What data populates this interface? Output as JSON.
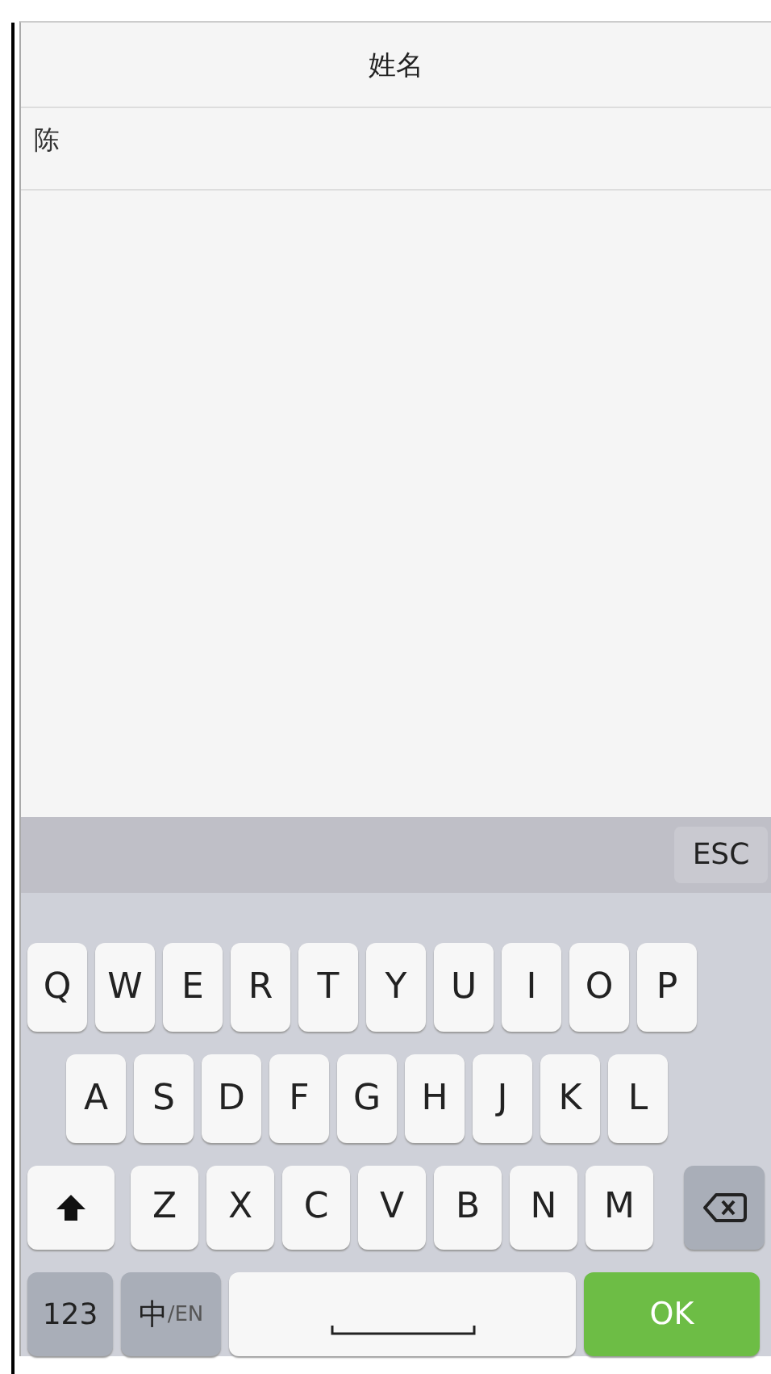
{
  "header": {
    "title": "姓名"
  },
  "field": {
    "value": "陈"
  },
  "toolbar": {
    "esc": "ESC"
  },
  "keyboard": {
    "rows": [
      [
        "Q",
        "W",
        "E",
        "R",
        "T",
        "Y",
        "U",
        "I",
        "O",
        "P"
      ],
      [
        "A",
        "S",
        "D",
        "F",
        "G",
        "H",
        "J",
        "K",
        "L"
      ],
      [
        "Z",
        "X",
        "C",
        "V",
        "B",
        "N",
        "M"
      ]
    ],
    "numbers_key": "123",
    "lang_key": {
      "main": "中",
      "sub": "/EN"
    },
    "ok_key": "OK"
  }
}
